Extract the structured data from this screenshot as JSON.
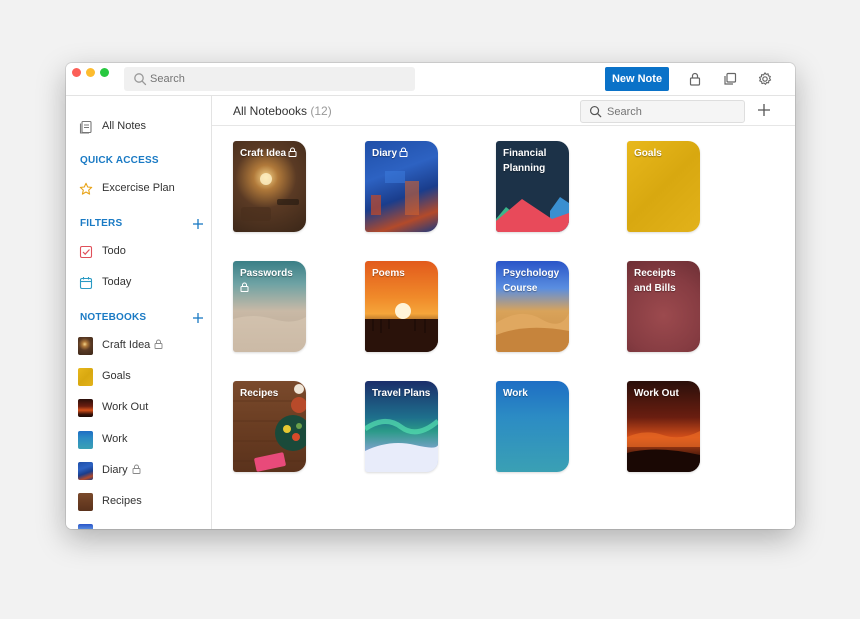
{
  "window": {
    "search_placeholder": "Search",
    "new_note_label": "New Note"
  },
  "sidebar": {
    "all_notes": "All Notes",
    "quick_access_heading": "QUICK ACCESS",
    "quick_access": [
      {
        "label": "Excercise Plan",
        "icon": "star-icon"
      }
    ],
    "filters_heading": "FILTERS",
    "filters": [
      {
        "label": "Todo",
        "icon": "checkbox-icon"
      },
      {
        "label": "Today",
        "icon": "calendar-icon"
      }
    ],
    "notebooks_heading": "NOTEBOOKS",
    "notebooks": [
      {
        "label": "Craft Idea",
        "locked": true
      },
      {
        "label": "Goals",
        "locked": false
      },
      {
        "label": "Work Out",
        "locked": false
      },
      {
        "label": "Work",
        "locked": false
      },
      {
        "label": "Diary",
        "locked": true
      },
      {
        "label": "Recipes",
        "locked": false
      }
    ]
  },
  "main": {
    "title": "All Notebooks",
    "count": "(12)",
    "search_placeholder": "Search",
    "notebooks": [
      {
        "title": "Craft Idea",
        "locked": true
      },
      {
        "title": "Diary",
        "locked": true
      },
      {
        "title": "Financial Planning",
        "locked": false
      },
      {
        "title": "Goals",
        "locked": false
      },
      {
        "title": "Passwords",
        "locked": true
      },
      {
        "title": "Poems",
        "locked": false
      },
      {
        "title": "Psychology Course",
        "locked": false
      },
      {
        "title": "Receipts and Bills",
        "locked": false
      },
      {
        "title": "Recipes",
        "locked": false
      },
      {
        "title": "Travel Plans",
        "locked": false
      },
      {
        "title": "Work",
        "locked": false
      },
      {
        "title": "Work Out",
        "locked": false
      }
    ]
  },
  "colors": {
    "accent": "#0a72c8",
    "section_heading": "#1a7ac4"
  }
}
